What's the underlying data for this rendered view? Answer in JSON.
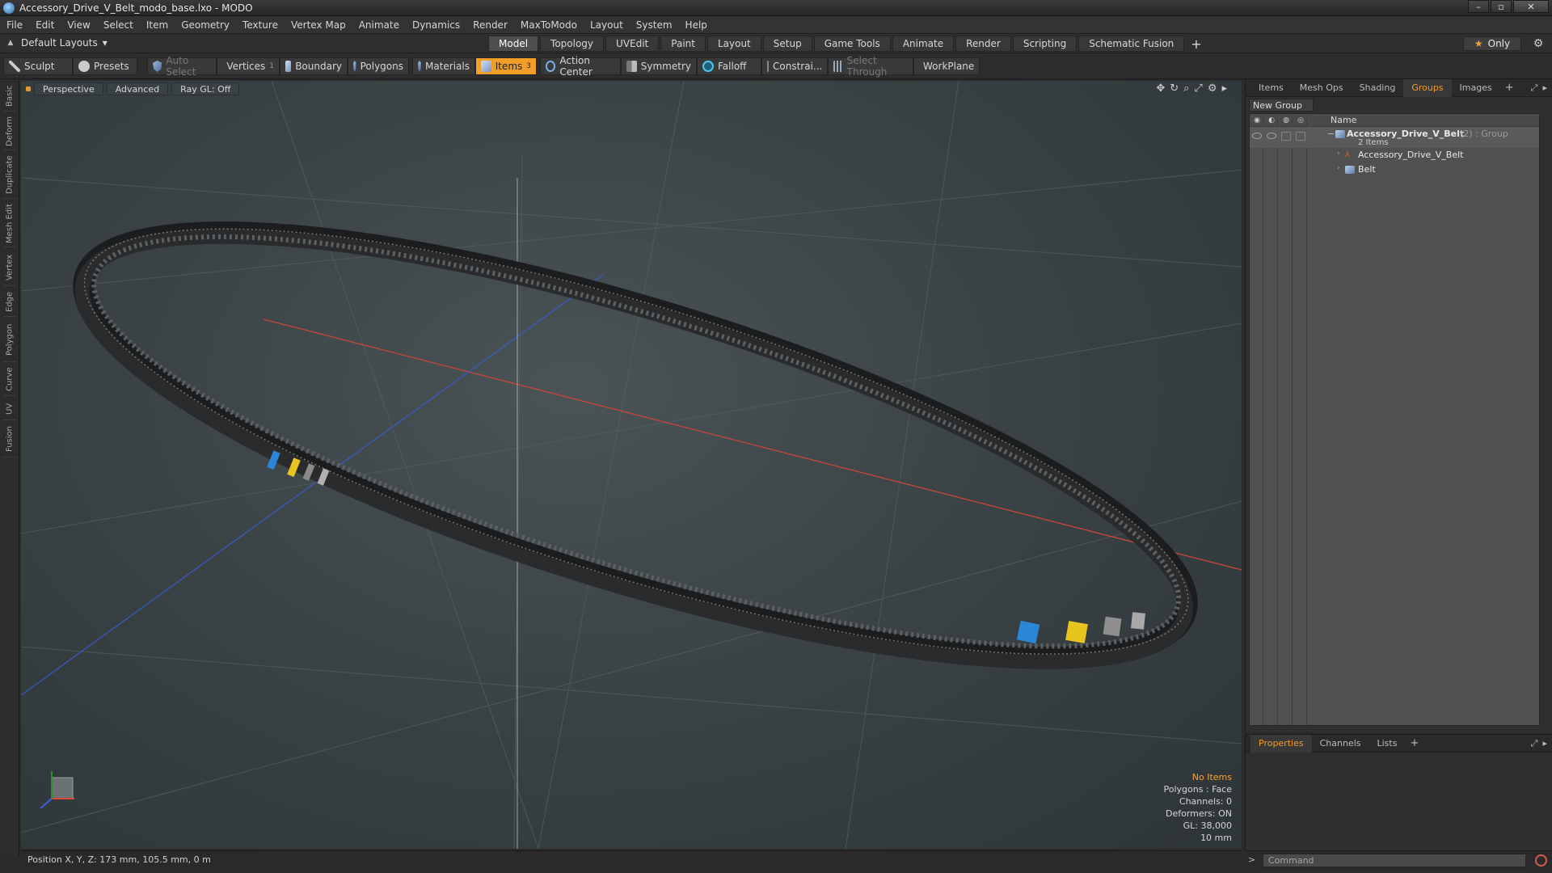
{
  "window": {
    "title": "Accessory_Drive_V_Belt_modo_base.lxo - MODO",
    "controls": [
      "–",
      "▫",
      "✕"
    ]
  },
  "menu": [
    "File",
    "Edit",
    "View",
    "Select",
    "Item",
    "Geometry",
    "Texture",
    "Vertex Map",
    "Animate",
    "Dynamics",
    "Render",
    "MaxToModo",
    "Layout",
    "System",
    "Help"
  ],
  "layout": {
    "preset": "Default Layouts",
    "preset_arrow": "▾",
    "tabs": [
      "Model",
      "Topology",
      "UVEdit",
      "Paint",
      "Layout",
      "Setup",
      "Game Tools",
      "Animate",
      "Render",
      "Scripting",
      "Schematic Fusion"
    ],
    "active_tab": "Model",
    "add_tab": "+",
    "only_label": "Only",
    "star": "★",
    "gear": "⚙"
  },
  "toolbar": {
    "sculpt": "Sculpt",
    "presets": "Presets",
    "auto_select": "Auto Select",
    "vertices": "Vertices",
    "vertices_count": "1",
    "boundary": "Boundary",
    "polygons": "Polygons",
    "materials": "Materials",
    "items": "Items",
    "items_count": "3",
    "action_center": "Action Center",
    "symmetry": "Symmetry",
    "falloff": "Falloff",
    "constrain": "Constrai...",
    "select_through": "Select Through",
    "workplane": "WorkPlane"
  },
  "left_tabs": [
    "Basic",
    "Deform",
    "Duplicate",
    "Mesh Edit",
    "Vertex",
    "Edge",
    "Polygon",
    "Curve",
    "UV",
    "Fusion"
  ],
  "viewport": {
    "view_mode": "Perspective",
    "shading": "Advanced",
    "raygl": "Ray GL: Off",
    "icons": [
      "✥",
      "↻",
      "⌕",
      "⤢",
      "⚙",
      "▸"
    ],
    "info": {
      "no_items": "No Items",
      "polygons": "Polygons : Face",
      "channels": "Channels: 0",
      "deformers": "Deformers: ON",
      "gl": "GL: 38,000",
      "scale": "10 mm"
    }
  },
  "status": {
    "position": "Position X, Y, Z:  173 mm, 105.5 mm, 0 m"
  },
  "right_panel": {
    "tabs": [
      "Items",
      "Mesh Ops",
      "Shading",
      "Groups",
      "Images"
    ],
    "active_tab": "Groups",
    "add_tab": "+",
    "corner_icons": [
      "⤢",
      "▸"
    ],
    "new_group": "New Group",
    "name_header": "Name",
    "group": {
      "name": "Accessory_Drive_V_Belt",
      "meta": "(2) : Group",
      "count": "2 Items",
      "children": [
        "Accessory_Drive_V_Belt",
        "Belt"
      ]
    }
  },
  "bottom_panel": {
    "tabs": [
      "Properties",
      "Channels",
      "Lists"
    ],
    "active_tab": "Properties",
    "add_tab": "+"
  },
  "command": {
    "placeholder": "Command",
    "prompt": ">"
  },
  "colors": {
    "accent": "#f29d28",
    "x_axis": "#e0483c",
    "y_axis": "#2f8f2f",
    "z_axis": "#3a5fe0",
    "tag_blue": "#2a86d6",
    "tag_yellow": "#e8c41f"
  }
}
